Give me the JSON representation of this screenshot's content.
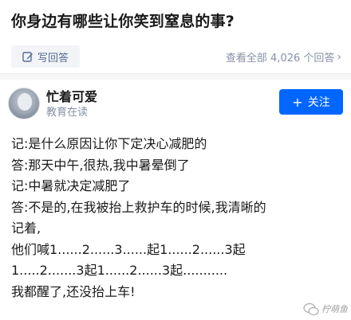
{
  "question": {
    "title": "你身边有哪些让你笑到窒息的事?"
  },
  "actions": {
    "write_answer_label": "写回答",
    "view_all_label": "查看全部 4,026 个回答"
  },
  "author": {
    "name": "忙着可爱",
    "subtitle": "教育在读",
    "follow_label": "关注"
  },
  "answer": {
    "lines": [
      "记:是什么原因让你下定决心减肥的",
      "答:那天中午,很热,我中暑晕倒了",
      "记:中暑就决定减肥了",
      "答:不是的,在我被抬上救护车的时候,我清晰的",
      "记着,",
      "他们喊1......2......3......起1......2......3起",
      "1.....2.......3起1......2......3起...........",
      "我都醒了,还没抬上车!"
    ]
  },
  "watermark": {
    "text": "柠萌鱼"
  },
  "colors": {
    "accent": "#0066ff",
    "link": "#576b95",
    "meta": "#8590a6"
  },
  "icons": {
    "write": "pencil-icon",
    "chevron": "chevron-right-icon",
    "follow": "plus-icon"
  }
}
